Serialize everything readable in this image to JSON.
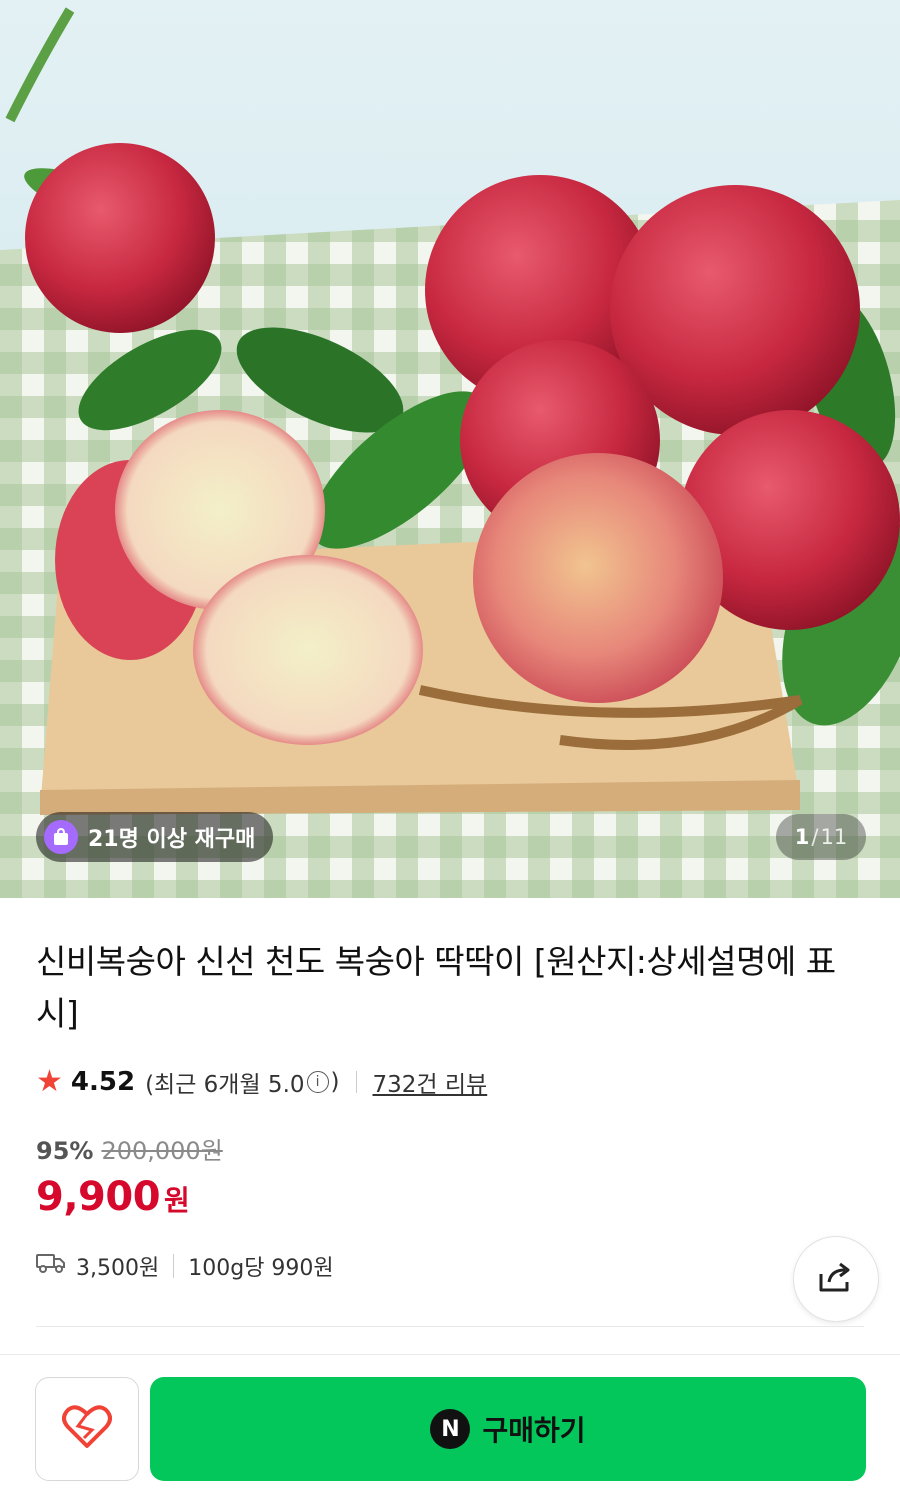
{
  "hero": {
    "image_desc_icon": "peach-product-photo",
    "rebuy_badge": "21명 이상 재구매",
    "counter_current": "1",
    "counter_separator": "/",
    "counter_total": "11"
  },
  "product": {
    "title": "신비복숭아 신선 천도 복숭아 딱딱이 [원산지:상세설명에 표시]",
    "rating": "4.52",
    "recent_rating_label": "(최근 6개월 5.0",
    "recent_rating_close": ")",
    "reviews_link": "732건 리뷰",
    "discount": "95%",
    "original_price": "200,000원",
    "price": "9,900",
    "price_unit": "원",
    "shipping_fee": "3,500원",
    "unit_price": "100g당 990원"
  },
  "bottom_bar": {
    "buy_label": "구매하기",
    "n_logo": "N"
  },
  "colors": {
    "price_red": "#d6082b",
    "star": "#f04336",
    "buy_green": "#03c75a",
    "badge_purple": "#a56bff"
  }
}
